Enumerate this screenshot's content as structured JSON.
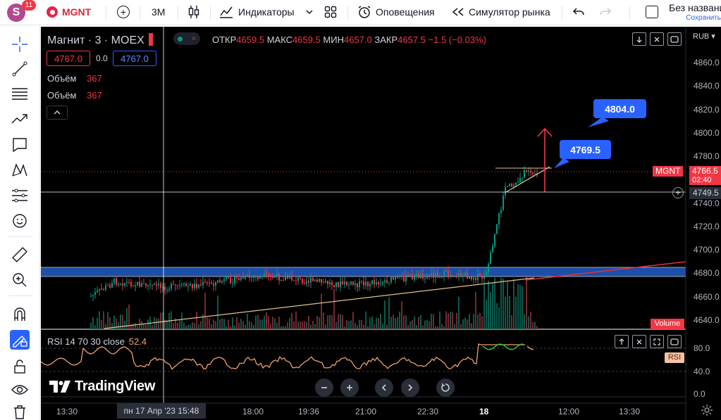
{
  "topbar": {
    "avatar_letter": "S",
    "notifications_count": "11",
    "symbol": "MGNT",
    "interval": "3M",
    "indicators_label": "Индикаторы",
    "alerts_label": "Оповещения",
    "replay_label": "Симулятор рынка",
    "layout_name": "Без названия",
    "save_label": "Сохранить"
  },
  "left_toolbar": {
    "icons": [
      "crosshair-icon",
      "trend-line-icon",
      "fib-retracement-icon",
      "pattern-icon",
      "text-callout-icon",
      "xabcd-pattern-icon",
      "long-position-icon",
      "emoji-icon",
      "ruler-icon",
      "zoom-in-icon",
      "magnet-icon",
      "lock-drawing-mode-icon",
      "lock-icon",
      "eye-icon",
      "trash-icon"
    ]
  },
  "legend": {
    "title": "Магнит · 3 · MOEX",
    "open_label": "ОТКР",
    "open": "4659.5",
    "high_label": "МАКС",
    "high": "4659.5",
    "low_label": "МИН",
    "low": "4657.0",
    "close_label": "ЗАКР",
    "close": "4657.5",
    "change": "−1.5 (−0.03%)",
    "sell_price": "4767.0",
    "spread": "0.0",
    "buy_price": "4767.0",
    "volume_label_1": "Объём",
    "volume_value_1": "367",
    "volume_label_2": "Объём",
    "volume_value_2": "367"
  },
  "price_axis": {
    "currency": "RUB",
    "ticks": [
      "4860.0",
      "4840.0",
      "4820.0",
      "4800.0",
      "4780.0",
      "4760.0",
      "4740.0",
      "4720.0",
      "4700.0",
      "4680.0",
      "4660.0",
      "4640.0"
    ],
    "last_price_symbol": "MGNT",
    "last_price": "4766.5",
    "countdown": "02:40",
    "crosshair_price": "4749.5",
    "volume_tag": "Volume"
  },
  "time_axis": {
    "ticks": [
      "13:30",
      "18:00",
      "19:36",
      "21:00",
      "22:30",
      "18",
      "12:00",
      "13:30"
    ],
    "crosshair_time": "пн 17 Апр '23   15:48"
  },
  "drawings": {
    "callout_1": "4804.0",
    "callout_2": "4769.5"
  },
  "rsi": {
    "legend": "RSI 14 70 30 close",
    "value": "52.4",
    "tag": "RSI",
    "ticks": [
      "80.0",
      "40.0",
      "0.0"
    ]
  },
  "branding": {
    "logo_text": "TradingView"
  },
  "colors": {
    "up": "#089981",
    "down": "#f23645",
    "accent": "#2962ff",
    "zone": "#2962ff",
    "rsi_line": "#f0a06a"
  }
}
